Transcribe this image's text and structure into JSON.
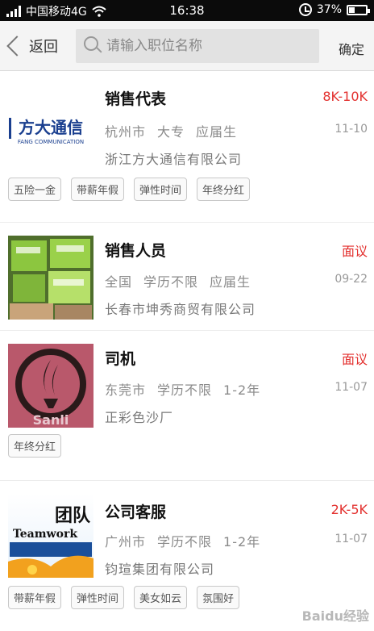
{
  "status_bar": {
    "carrier": "中国移动4G",
    "time": "16:38",
    "battery": "37%",
    "battery_level": 0.37
  },
  "header": {
    "back_label": "返回",
    "search_placeholder": "请输入职位名称",
    "confirm_label": "确定"
  },
  "jobs": [
    {
      "title": "销售代表",
      "salary": "8K-10K",
      "city": "杭州市",
      "education": "大专",
      "experience": "应届生",
      "date": "11-10",
      "company": "浙江方大通信有限公司",
      "logo_text": "方大通信",
      "logo_subtext": "FANG COMMUNICATION",
      "tags": [
        "五险一金",
        "带薪年假",
        "弹性时间",
        "年终分红"
      ]
    },
    {
      "title": "销售人员",
      "salary": "面议",
      "city": "全国",
      "education": "学历不限",
      "experience": "应届生",
      "date": "09-22",
      "company": "长春市坤秀商贸有限公司",
      "tags": []
    },
    {
      "title": "司机",
      "salary": "面议",
      "city": "东莞市",
      "education": "学历不限",
      "experience": "1-2年",
      "date": "11-07",
      "company": "正彩色沙厂",
      "logo_text": "Sanli",
      "tags": [
        "年终分红"
      ]
    },
    {
      "title": "公司客服",
      "salary": "2K-5K",
      "city": "广州市",
      "education": "学历不限",
      "experience": "1-2年",
      "date": "11-07",
      "company": "钧瑄集团有限公司",
      "logo_text": "Teamwork",
      "logo_text_cn": "团队",
      "tags": [
        "带薪年假",
        "弹性时间",
        "美女如云",
        "氛围好"
      ]
    }
  ],
  "watermark": "Baidu经验"
}
